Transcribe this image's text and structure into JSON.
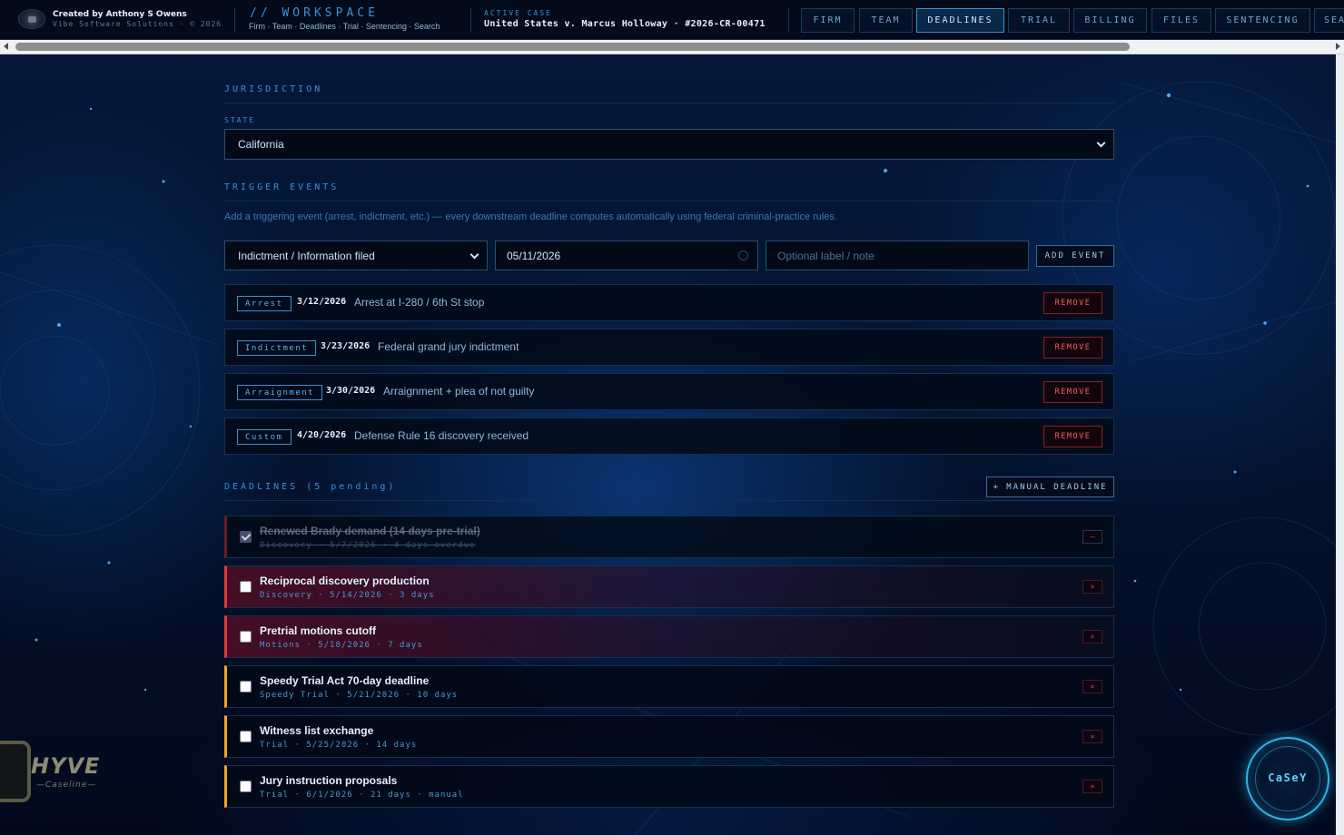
{
  "topbar": {
    "credit": "Created by Anthony S Owens",
    "company": "Vibe Software Solutions · © 2026",
    "workspace_title": "// WORKSPACE",
    "workspace_links": "Firm · Team · Deadlines · Trial · Sentencing · Search",
    "case_label": "ACTIVE CASE",
    "case_name": "United States v. Marcus Holloway · #2026-CR-00471",
    "nav": [
      {
        "label": "FIRM"
      },
      {
        "label": "TEAM"
      },
      {
        "label": "DEADLINES",
        "active": true
      },
      {
        "label": "TRIAL"
      },
      {
        "label": "BILLING"
      },
      {
        "label": "FILES"
      },
      {
        "label": "SENTENCING"
      },
      {
        "label": "SEA"
      }
    ]
  },
  "jurisdiction": {
    "heading": "JURISDICTION",
    "state_label": "STATE",
    "state_value": "California"
  },
  "triggers": {
    "heading": "TRIGGER EVENTS",
    "hint": "Add a triggering event (arrest, indictment, etc.) — every downstream deadline computes automatically using federal criminal-practice rules.",
    "event_type": "Indictment / Information filed",
    "event_date": "05/11/2026",
    "note_placeholder": "Optional label / note",
    "add_button": "ADD EVENT",
    "events": [
      {
        "tag": "Arrest",
        "date": "3/12/2026",
        "desc": "Arrest at I-280 / 6th St stop",
        "remove": "REMOVE"
      },
      {
        "tag": "Indictment",
        "date": "3/23/2026",
        "desc": "Federal grand jury indictment",
        "remove": "REMOVE"
      },
      {
        "tag": "Arraignment",
        "date": "3/30/2026",
        "desc": "Arraignment + plea of not guilty",
        "remove": "REMOVE"
      },
      {
        "tag": "Custom",
        "date": "4/20/2026",
        "desc": "Defense Rule 16 discovery received",
        "remove": "REMOVE"
      }
    ]
  },
  "deadlines": {
    "heading": "DEADLINES (5 pending)",
    "manual_button": "+ MANUAL DEADLINE",
    "items": [
      {
        "title": "Renewed Brady demand (14 days pre-trial)",
        "meta": "Discovery · 5/7/2026 · 4 days overdue",
        "done": true,
        "delete": "—"
      },
      {
        "title": "Reciprocal discovery production",
        "meta": "Discovery · 5/14/2026 · 3 days",
        "status": "red",
        "delete": "×"
      },
      {
        "title": "Pretrial motions cutoff",
        "meta": "Motions · 5/18/2026 · 7 days",
        "status": "red",
        "delete": "×"
      },
      {
        "title": "Speedy Trial Act 70-day deadline",
        "meta": "Speedy Trial · 5/21/2026 · 10 days",
        "status": "amber",
        "delete": "×"
      },
      {
        "title": "Witness list exchange",
        "meta": "Trial · 5/25/2026 · 14 days",
        "status": "amber",
        "delete": "×"
      },
      {
        "title": "Jury instruction proposals",
        "meta": "Trial · 6/1/2026 · 21 days · manual",
        "status": "amber",
        "delete": "×"
      }
    ]
  },
  "branding": {
    "hyve": "HYVE",
    "hyve_sub": "—Caseline—",
    "assistant": "CaSeY"
  },
  "colors": {
    "accent": "#3b8fd6",
    "danger": "#e5383b",
    "warning": "#f2a623",
    "background": "#031028"
  }
}
